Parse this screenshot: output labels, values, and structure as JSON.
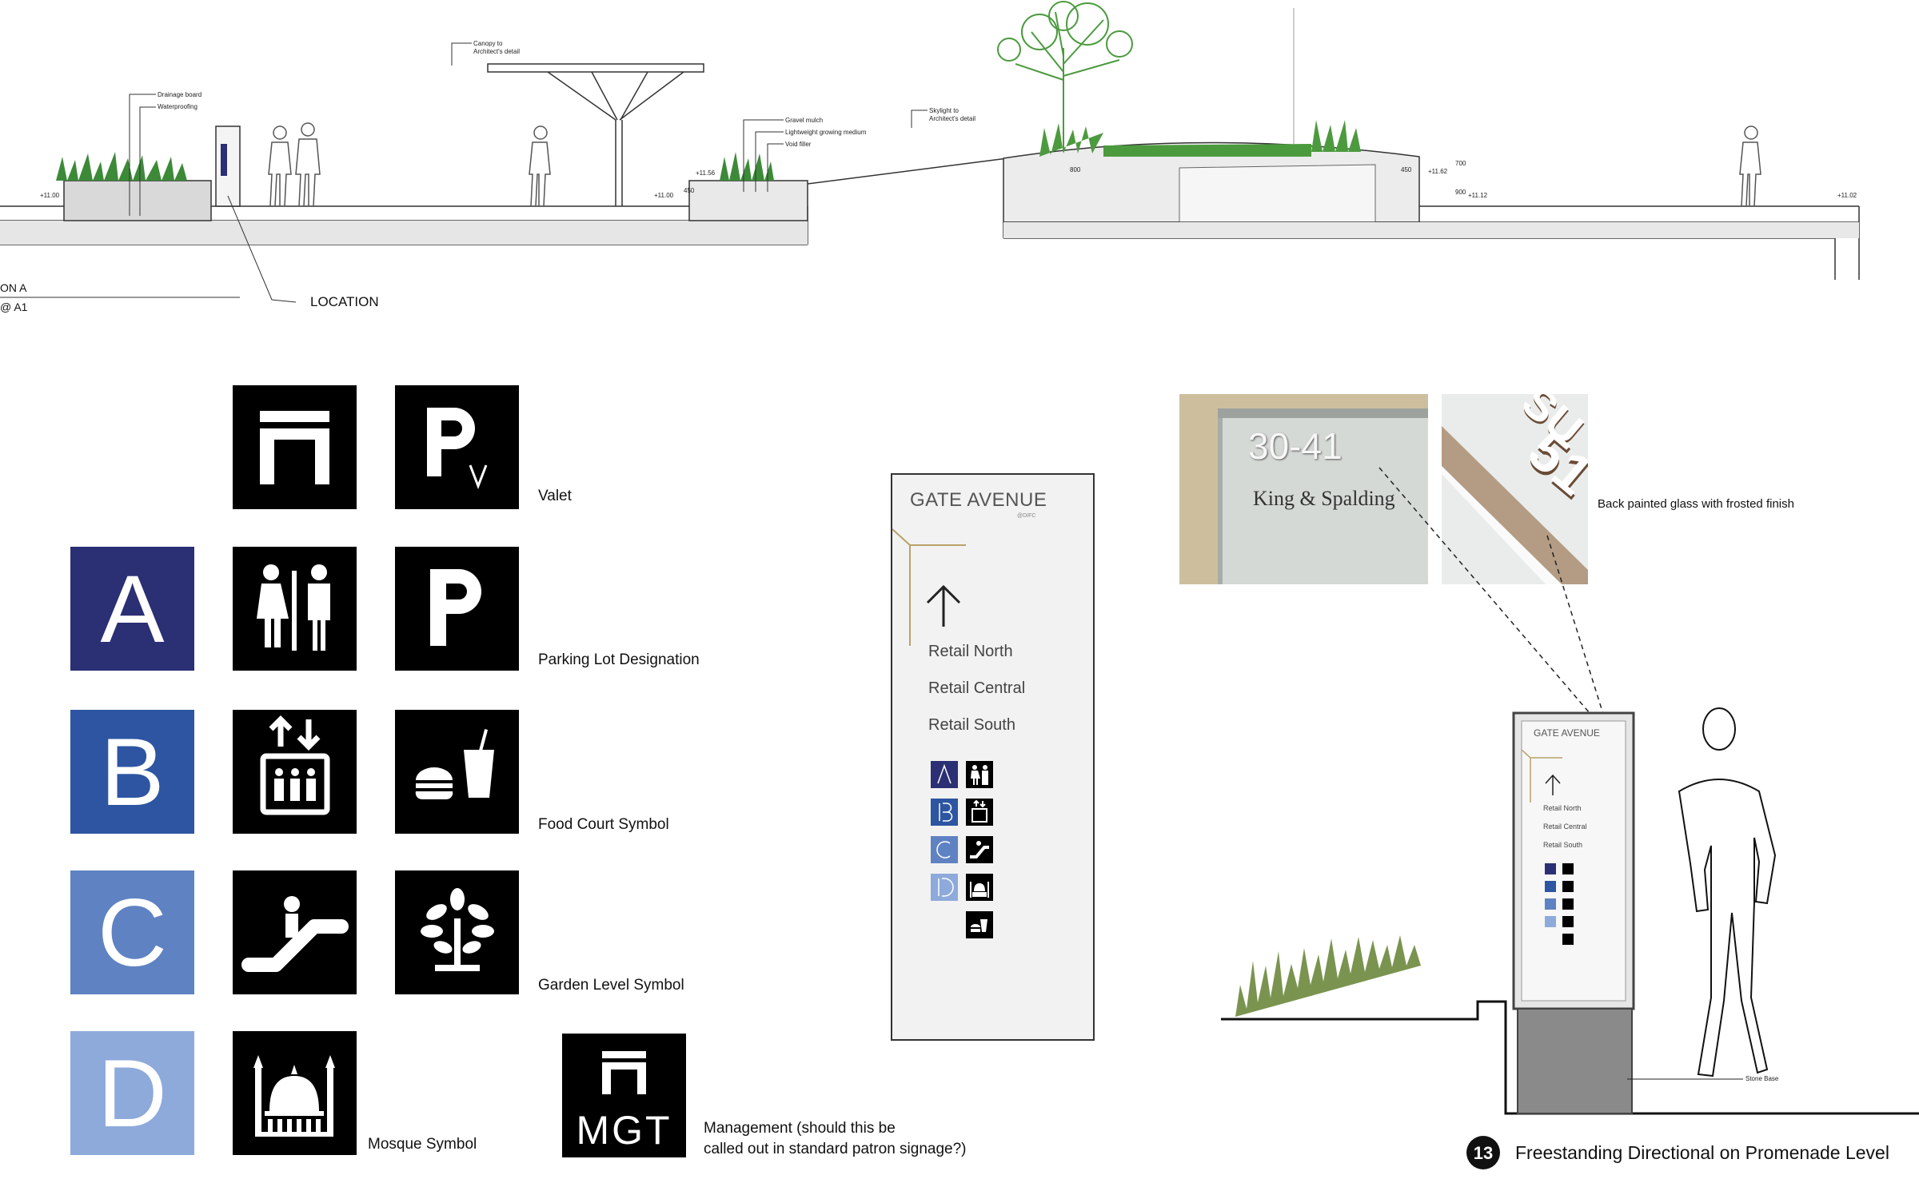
{
  "section": {
    "annotations": {
      "canopy": [
        "Canopy to",
        "Architect's detail"
      ],
      "drainage": "Drainage board",
      "waterproofing": "Waterproofing",
      "gravel": "Gravel mulch",
      "lightweight": "Lightweight growing medium",
      "void": "Void filler",
      "skylight": [
        "Skylight to",
        "Architect's detail"
      ]
    },
    "levels": {
      "l1": "+11.00",
      "l2": "+11.00",
      "l3": "+11.56",
      "l4": "+11.62",
      "l5": "+11.12",
      "l6": "+11.02"
    },
    "dims": {
      "d1": "450",
      "d2": "800",
      "d3": "450",
      "d4": "700",
      "d5": "900"
    },
    "location_label": "LOCATION",
    "section_ref": [
      "ON A",
      "@ A1"
    ]
  },
  "symbols": {
    "letters": [
      {
        "letter": "A",
        "color": "#2b2f73"
      },
      {
        "letter": "B",
        "color": "#2d55a2"
      },
      {
        "letter": "C",
        "color": "#5f82c3"
      },
      {
        "letter": "D",
        "color": "#8eaadb"
      }
    ],
    "mgt_text": "MGT",
    "captions": {
      "valet": "Valet",
      "parking": "Parking Lot Designation",
      "food": "Food Court Symbol",
      "garden": "Garden Level Symbol",
      "mosque": "Mosque Symbol",
      "management": [
        "Management (should this be",
        "called out in standard patron signage?)"
      ]
    }
  },
  "sign": {
    "brand": "GATE AVENUE",
    "brand_sub": "@DIFC",
    "destinations": [
      "Retail North",
      "Retail Central",
      "Retail South"
    ],
    "accent_color": "#b8a26a"
  },
  "photos": {
    "photo1_number": "30-41",
    "photo1_text": "King & Spalding",
    "photo2_number": "51",
    "photo2_text": "SU",
    "note": "Back painted glass with frosted finish"
  },
  "elevation": {
    "brand": "GATE AVENUE",
    "destinations": [
      "Retail North",
      "Retail Central",
      "Retail South"
    ],
    "base_label": "Stone Base",
    "number": "13",
    "title": "Freestanding Directional on Promenade Level"
  }
}
